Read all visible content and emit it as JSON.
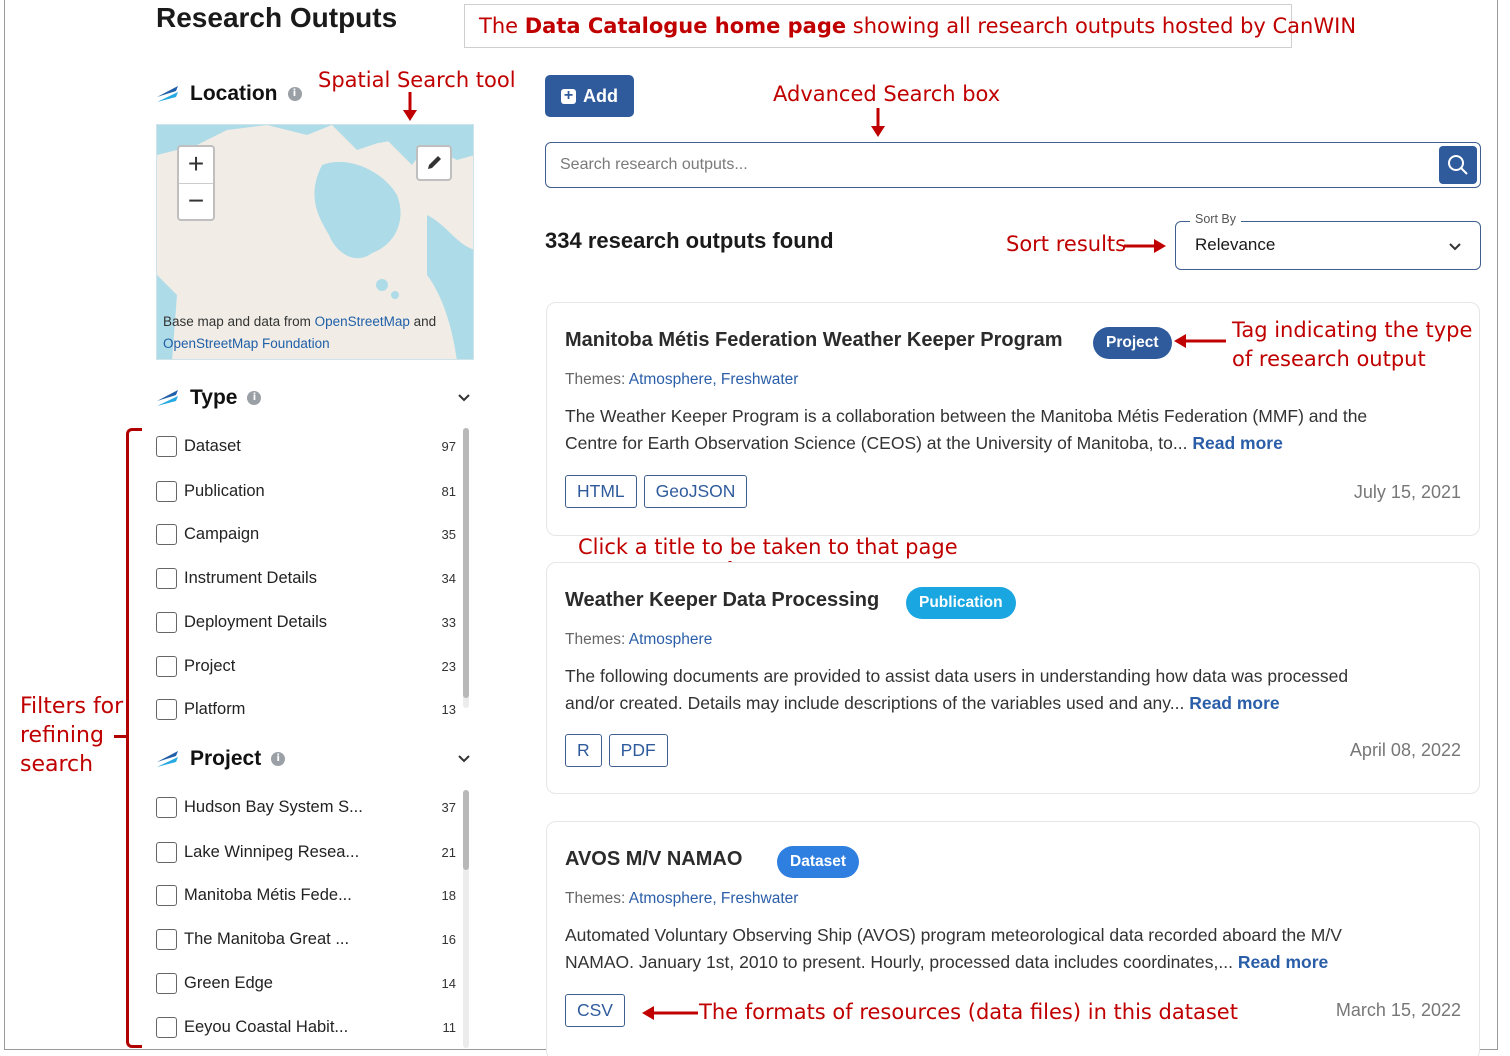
{
  "page": {
    "title": "Research Outputs",
    "caption_prefix": "The ",
    "caption_bold": "Data Catalogue home page",
    "caption_suffix": " showing all research outputs hosted by CanWIN"
  },
  "annotations": {
    "spatial_search": "Spatial Search tool",
    "advanced_search": "Advanced Search box",
    "sort_results": "Sort results",
    "tag_line1": "Tag indicating the type",
    "tag_line2": "of research output",
    "click_title": "Click a title to be taken to that page",
    "filters_line1": "Filters for",
    "filters_line2": "refining",
    "filters_line3": "search",
    "formats": "The formats of resources (data files) in this dataset"
  },
  "location": {
    "label": "Location",
    "attribution_prefix": "Base map and data from ",
    "attribution_link1": "OpenStreetMap",
    "attribution_mid": " and",
    "attribution_link2": "OpenStreetMap Foundation",
    "zoom_in": "+",
    "zoom_out": "−"
  },
  "type_filter": {
    "label": "Type",
    "items": [
      {
        "label": "Dataset",
        "count": "97"
      },
      {
        "label": "Publication",
        "count": "81"
      },
      {
        "label": "Campaign",
        "count": "35"
      },
      {
        "label": "Instrument Details",
        "count": "34"
      },
      {
        "label": "Deployment Details",
        "count": "33"
      },
      {
        "label": "Project",
        "count": "23"
      },
      {
        "label": "Platform",
        "count": "13"
      }
    ]
  },
  "project_filter": {
    "label": "Project",
    "items": [
      {
        "label": "Hudson Bay System S...",
        "count": "37"
      },
      {
        "label": "Lake Winnipeg Resea...",
        "count": "21"
      },
      {
        "label": "Manitoba Métis Fede...",
        "count": "18"
      },
      {
        "label": "The Manitoba Great ...",
        "count": "16"
      },
      {
        "label": "Green Edge",
        "count": "14"
      },
      {
        "label": "Eeyou Coastal Habit...",
        "count": "11"
      }
    ]
  },
  "toolbar": {
    "add_label": "Add"
  },
  "search": {
    "placeholder": "Search research outputs..."
  },
  "results": {
    "count_text": "334 research outputs found"
  },
  "sort": {
    "label": "Sort By",
    "value": "Relevance"
  },
  "colors": {
    "accent": "#2f5b9c",
    "annotation": "#c00000",
    "badge_project": "#2f5b9c",
    "badge_publication": "#1aa6e0",
    "badge_dataset": "#2f7fe0"
  },
  "cards": [
    {
      "title": "Manitoba Métis Federation Weather Keeper Program",
      "badge": "Project",
      "themes_label": "Themes: ",
      "themes": "Atmosphere, Freshwater",
      "desc_line1": "The Weather Keeper Program is a collaboration between the Manitoba Métis Federation (MMF) and the",
      "desc_line2": "Centre for Earth Observation Science (CEOS) at the University of Manitoba, to... ",
      "read_more": "Read more",
      "formats": [
        "HTML",
        "GeoJSON"
      ],
      "date": "July 15, 2021"
    },
    {
      "title": "Weather Keeper Data Processing",
      "badge": "Publication",
      "themes_label": "Themes: ",
      "themes": "Atmosphere",
      "desc_line1": "The following documents are provided to assist data users in understanding how data was processed",
      "desc_line2": "and/or created. Details may include descriptions of the variables used and any... ",
      "read_more": "Read more",
      "formats": [
        "R",
        "PDF"
      ],
      "date": "April 08, 2022"
    },
    {
      "title": "AVOS M/V NAMAO",
      "badge": "Dataset",
      "themes_label": "Themes: ",
      "themes": "Atmosphere, Freshwater",
      "desc_line1": "Automated Voluntary Observing Ship (AVOS) program meteorological data recorded aboard the M/V",
      "desc_line2": "NAMAO. January 1st, 2010 to present. Hourly, processed data includes coordinates,... ",
      "read_more": "Read more",
      "formats": [
        "CSV"
      ],
      "date": "March 15, 2022"
    }
  ]
}
